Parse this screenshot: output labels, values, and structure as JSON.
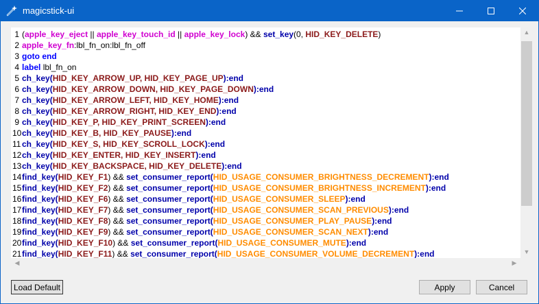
{
  "window": {
    "title": "magicstick-ui",
    "icon": "magic-wand-icon",
    "accent": "#0a64c8"
  },
  "editor": {
    "lines": [
      {
        "n": "1",
        "tokens": [
          [
            "txt",
            "("
          ],
          [
            "apple",
            "apple_key_eject"
          ],
          [
            "txt",
            " || "
          ],
          [
            "apple",
            "apple_key_touch_id"
          ],
          [
            "txt",
            " || "
          ],
          [
            "apple",
            "apple_key_lock"
          ],
          [
            "txt",
            ") && "
          ],
          [
            "fn",
            "set_key"
          ],
          [
            "txt",
            "(0, "
          ],
          [
            "hid",
            "HID_KEY_DELETE"
          ],
          [
            "txt",
            ")"
          ]
        ]
      },
      {
        "n": "2",
        "tokens": [
          [
            "apple",
            "apple_key_fn"
          ],
          [
            "txt",
            ":lbl_fn_on:lbl_fn_off"
          ]
        ]
      },
      {
        "n": "3",
        "tokens": [
          [
            "kw",
            "goto end"
          ]
        ]
      },
      {
        "n": "4",
        "tokens": [
          [
            "kw",
            "label"
          ],
          [
            "txt",
            " lbl_fn_on"
          ]
        ]
      },
      {
        "n": "5",
        "tokens": [
          [
            "fn",
            "ch_key("
          ],
          [
            "hid",
            "HID_KEY_ARROW_UP, HID_KEY_PAGE_UP"
          ],
          [
            "fn",
            "):end"
          ]
        ]
      },
      {
        "n": "6",
        "tokens": [
          [
            "fn",
            "ch_key("
          ],
          [
            "hid",
            "HID_KEY_ARROW_DOWN, HID_KEY_PAGE_DOWN"
          ],
          [
            "fn",
            "):end"
          ]
        ]
      },
      {
        "n": "7",
        "tokens": [
          [
            "fn",
            "ch_key("
          ],
          [
            "hid",
            "HID_KEY_ARROW_LEFT, HID_KEY_HOME"
          ],
          [
            "fn",
            "):end"
          ]
        ]
      },
      {
        "n": "8",
        "tokens": [
          [
            "fn",
            "ch_key("
          ],
          [
            "hid",
            "HID_KEY_ARROW_RIGHT, HID_KEY_END"
          ],
          [
            "fn",
            "):end"
          ]
        ]
      },
      {
        "n": "9",
        "tokens": [
          [
            "fn",
            "ch_key("
          ],
          [
            "hid",
            "HID_KEY_P, HID_KEY_PRINT_SCREEN"
          ],
          [
            "fn",
            "):end"
          ]
        ]
      },
      {
        "n": "10",
        "tokens": [
          [
            "fn",
            "ch_key("
          ],
          [
            "hid",
            "HID_KEY_B, HID_KEY_PAUSE"
          ],
          [
            "fn",
            "):end"
          ]
        ]
      },
      {
        "n": "11",
        "tokens": [
          [
            "fn",
            "ch_key("
          ],
          [
            "hid",
            "HID_KEY_S, HID_KEY_SCROLL_LOCK"
          ],
          [
            "fn",
            "):end"
          ]
        ]
      },
      {
        "n": "12",
        "tokens": [
          [
            "fn",
            "ch_key("
          ],
          [
            "hid",
            "HID_KEY_ENTER, HID_KEY_INSERT"
          ],
          [
            "fn",
            "):end"
          ]
        ]
      },
      {
        "n": "13",
        "tokens": [
          [
            "fn",
            "ch_key("
          ],
          [
            "hid",
            "HID_KEY_BACKSPACE, HID_KEY_DELETE"
          ],
          [
            "fn",
            "):end"
          ]
        ]
      },
      {
        "n": "14",
        "tokens": [
          [
            "fn",
            "find_key("
          ],
          [
            "hid",
            "HID_KEY_F1"
          ],
          [
            "txt",
            ") && "
          ],
          [
            "fn",
            "set_consumer_report("
          ],
          [
            "usage",
            "HID_USAGE_CONSUMER_BRIGHTNESS_DECREMENT"
          ],
          [
            "fn",
            "):end"
          ]
        ]
      },
      {
        "n": "15",
        "tokens": [
          [
            "fn",
            "find_key("
          ],
          [
            "hid",
            "HID_KEY_F2"
          ],
          [
            "txt",
            ") && "
          ],
          [
            "fn",
            "set_consumer_report("
          ],
          [
            "usage",
            "HID_USAGE_CONSUMER_BRIGHTNESS_INCREMENT"
          ],
          [
            "fn",
            "):end"
          ]
        ]
      },
      {
        "n": "16",
        "tokens": [
          [
            "fn",
            "find_key("
          ],
          [
            "hid",
            "HID_KEY_F6"
          ],
          [
            "txt",
            ") && "
          ],
          [
            "fn",
            "set_consumer_report("
          ],
          [
            "usage",
            "HID_USAGE_CONSUMER_SLEEP"
          ],
          [
            "fn",
            "):end"
          ]
        ]
      },
      {
        "n": "17",
        "tokens": [
          [
            "fn",
            "find_key("
          ],
          [
            "hid",
            "HID_KEY_F7"
          ],
          [
            "txt",
            ") && "
          ],
          [
            "fn",
            "set_consumer_report("
          ],
          [
            "usage",
            "HID_USAGE_CONSUMER_SCAN_PREVIOUS"
          ],
          [
            "fn",
            "):end"
          ]
        ]
      },
      {
        "n": "18",
        "tokens": [
          [
            "fn",
            "find_key("
          ],
          [
            "hid",
            "HID_KEY_F8"
          ],
          [
            "txt",
            ") && "
          ],
          [
            "fn",
            "set_consumer_report("
          ],
          [
            "usage",
            "HID_USAGE_CONSUMER_PLAY_PAUSE"
          ],
          [
            "fn",
            "):end"
          ]
        ]
      },
      {
        "n": "19",
        "tokens": [
          [
            "fn",
            "find_key("
          ],
          [
            "hid",
            "HID_KEY_F9"
          ],
          [
            "txt",
            ") && "
          ],
          [
            "fn",
            "set_consumer_report("
          ],
          [
            "usage",
            "HID_USAGE_CONSUMER_SCAN_NEXT"
          ],
          [
            "fn",
            "):end"
          ]
        ]
      },
      {
        "n": "20",
        "tokens": [
          [
            "fn",
            "find_key("
          ],
          [
            "hid",
            "HID_KEY_F10"
          ],
          [
            "txt",
            ") && "
          ],
          [
            "fn",
            "set_consumer_report("
          ],
          [
            "usage",
            "HID_USAGE_CONSUMER_MUTE"
          ],
          [
            "fn",
            "):end"
          ]
        ]
      },
      {
        "n": "21",
        "tokens": [
          [
            "fn",
            "find_key("
          ],
          [
            "hid",
            "HID_KEY_F11"
          ],
          [
            "txt",
            ") && "
          ],
          [
            "fn",
            "set_consumer_report("
          ],
          [
            "usage",
            "HID_USAGE_CONSUMER_VOLUME_DECREMENT"
          ],
          [
            "fn",
            "):end"
          ]
        ]
      }
    ]
  },
  "buttons": {
    "load_default": "Load Default",
    "apply": "Apply",
    "cancel": "Cancel"
  }
}
